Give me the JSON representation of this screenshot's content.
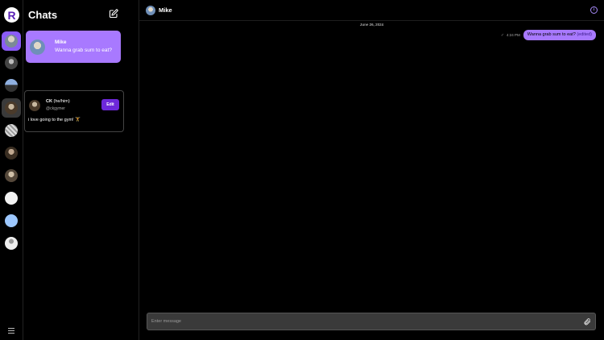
{
  "app": {
    "logo_letter": "R"
  },
  "rail": {
    "avatars": [
      {
        "name": "mike",
        "color": "#8a9bb0"
      },
      {
        "name": "user-2",
        "color": "#6b6b6b"
      },
      {
        "name": "user-3",
        "color": "#5a77a3"
      },
      {
        "name": "ck",
        "color": "#7a6a5a"
      },
      {
        "name": "user-5",
        "color": "#c8c8c8"
      },
      {
        "name": "user-6",
        "color": "#8a7a6a"
      },
      {
        "name": "user-7",
        "color": "#9a8a7a"
      },
      {
        "name": "user-8",
        "color": "#f2f2f2"
      },
      {
        "name": "user-9",
        "color": "#9dc8ff"
      },
      {
        "name": "user-10",
        "color": "#dddddd"
      }
    ]
  },
  "sidebar": {
    "title": "Chats",
    "chats": [
      {
        "name": "Mike",
        "preview": "Wanna grab sum to eat?"
      }
    ]
  },
  "profile": {
    "name": "CK",
    "pronouns": "(he/him)",
    "handle": "@ckgymer",
    "bio": "i love going to the gym! 🏋",
    "edit_label": "Edit"
  },
  "conversation": {
    "title": "Mike",
    "date": "June 26, 2024",
    "messages": [
      {
        "time": "4:24 PM",
        "text": "Wanna grab sum to eat?",
        "edited": "(edited)"
      }
    ],
    "input_placeholder": "Enter message"
  },
  "colors": {
    "accent": "#a879ff",
    "button": "#6d28d9"
  }
}
